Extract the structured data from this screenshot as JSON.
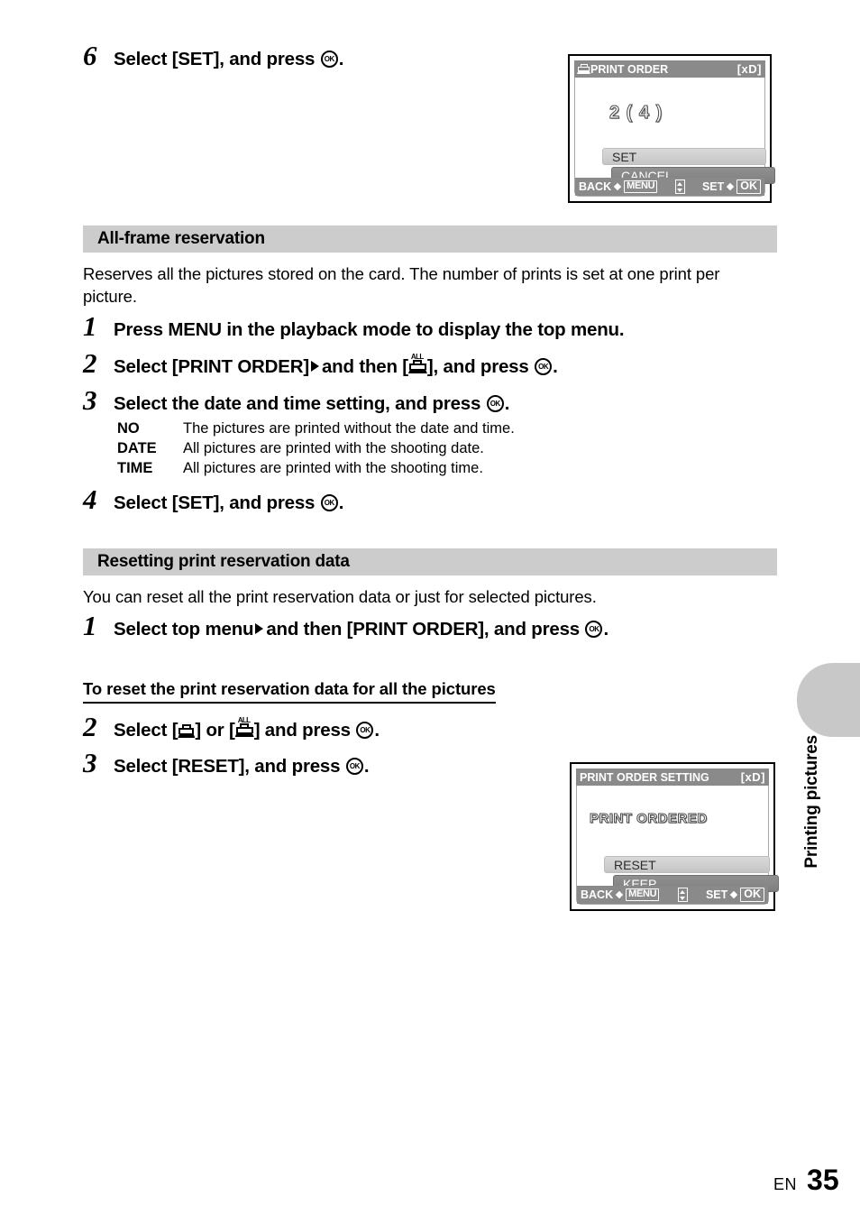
{
  "page": {
    "language_code": "EN",
    "page_number": "35",
    "side_tab_label": "Printing pictures"
  },
  "steps_top": [
    {
      "number": "6",
      "text_before": "Select [SET], and press",
      "icon": "ok-button-icon",
      "text_after": "."
    }
  ],
  "section_allframe": {
    "heading": "All-frame reservation",
    "intro": "Reserves all the pictures stored on the card. The number of prints is set at one print per picture.",
    "steps": [
      {
        "number": "1",
        "text": "Press MENU in the playback mode to display the top menu."
      },
      {
        "number": "2",
        "part1": "Select [PRINT ORDER]",
        "arrow_icon": "triangle-right-icon",
        "part2": "and then [",
        "printer_icon": "printer-all-icon",
        "part3": "], and press",
        "ok_icon": "ok-button-icon",
        "part4": "."
      },
      {
        "number": "3",
        "part1": "Select the date and time setting, and press",
        "ok_icon": "ok-button-icon",
        "part2": "."
      },
      {
        "number": "4",
        "part1": "Select [SET], and press",
        "ok_icon": "ok-button-icon",
        "part2": "."
      }
    ],
    "options": [
      {
        "key": "NO",
        "value": "The pictures are printed without the date and time."
      },
      {
        "key": "DATE",
        "value": "All pictures are printed with the shooting date."
      },
      {
        "key": "TIME",
        "value": "All pictures are printed with the shooting time."
      }
    ]
  },
  "section_resetting": {
    "heading": "Resetting print reservation data",
    "intro": "You can reset all the print reservation data or just for selected pictures.",
    "step1": {
      "number": "1",
      "part1": "Select top menu",
      "arrow_icon": "triangle-right-icon",
      "part2": "and then [PRINT ORDER], and press",
      "ok_icon": "ok-button-icon",
      "part3": "."
    },
    "subhead": "To reset the print reservation data for all the pictures",
    "step2": {
      "number": "2",
      "part1": "Select [",
      "printer_icon": "printer-icon",
      "part2": "] or [",
      "printer_all_icon": "printer-all-icon",
      "part3": "] and press",
      "ok_icon": "ok-button-icon",
      "part4": "."
    },
    "step3": {
      "number": "3",
      "part1": "Select [RESET], and press",
      "ok_icon": "ok-button-icon",
      "part2": "."
    }
  },
  "lcd_print_order": {
    "title": "PRINT ORDER",
    "title_icon": "printer-icon",
    "card_label": "[xD]",
    "value_display": "2 (  4 )",
    "menu_items": [
      {
        "label": "SET",
        "state": "selected"
      },
      {
        "label": "CANCEL",
        "state": "normal"
      }
    ],
    "status_bar": {
      "left_label": "BACK",
      "left_diamond_icon": "diamond-icon",
      "left_key": "MENU",
      "middle_icon": "up-down-arrows-icon",
      "right_label": "SET",
      "right_diamond_icon": "diamond-icon",
      "right_key": "OK"
    }
  },
  "lcd_print_order_setting": {
    "title": "PRINT ORDER SETTING",
    "card_label": "[xD]",
    "value_display": "PRINT ORDERED",
    "menu_items": [
      {
        "label": "RESET",
        "state": "selected"
      },
      {
        "label": "KEEP",
        "state": "normal"
      }
    ],
    "status_bar": {
      "left_label": "BACK",
      "left_diamond_icon": "diamond-icon",
      "left_key": "MENU",
      "middle_icon": "up-down-arrows-icon",
      "right_label": "SET",
      "right_diamond_icon": "diamond-icon",
      "right_key": "OK"
    }
  },
  "colors": {
    "band_gray": "#cccccc",
    "lcd_chrome_gray": "#8a8a8a",
    "tab_gray": "#c8c8c8"
  }
}
